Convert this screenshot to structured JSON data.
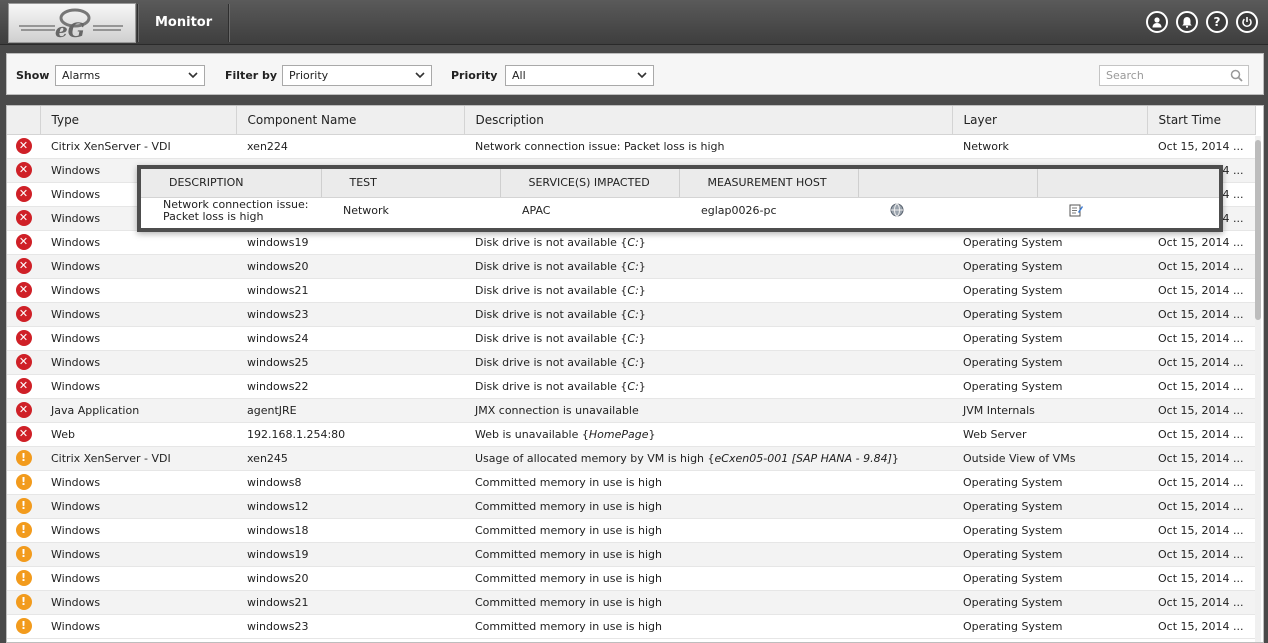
{
  "header": {
    "title": "Monitor",
    "icons": [
      "user-icon",
      "bell-icon",
      "help-icon",
      "power-icon"
    ]
  },
  "filters": {
    "show_label": "Show",
    "show_value": "Alarms",
    "filter_by_label": "Filter by",
    "filter_by_value": "Priority",
    "priority_label": "Priority",
    "priority_value": "All",
    "search_placeholder": "Search"
  },
  "table": {
    "columns": [
      "Type",
      "Component Name",
      "Description",
      "Layer",
      "Start Time"
    ],
    "rows": [
      {
        "priority": "critical",
        "type": "Citrix XenServer - VDI",
        "component": "xen224",
        "desc": "Network connection issue: Packet loss is high",
        "desc_em": "",
        "layer": "Network",
        "start": "Oct 15, 2014 ..."
      },
      {
        "priority": "critical",
        "type": "Windows",
        "component": "",
        "desc": "",
        "desc_em": "",
        "layer": "",
        "start": "Oct 15, 2014 ..."
      },
      {
        "priority": "critical",
        "type": "Windows",
        "component": "",
        "desc": "",
        "desc_em": "",
        "layer": "",
        "start": "Oct 15, 2014 ..."
      },
      {
        "priority": "critical",
        "type": "Windows",
        "component": "",
        "desc": "",
        "desc_em": "",
        "layer": "",
        "start": "Oct 15, 2014 ..."
      },
      {
        "priority": "critical",
        "type": "Windows",
        "component": "windows19",
        "desc": "Disk drive is not available {",
        "desc_em": "C:",
        "layer": "Operating System",
        "start": "Oct 15, 2014 ..."
      },
      {
        "priority": "critical",
        "type": "Windows",
        "component": "windows20",
        "desc": "Disk drive is not available {",
        "desc_em": "C:",
        "layer": "Operating System",
        "start": "Oct 15, 2014 ..."
      },
      {
        "priority": "critical",
        "type": "Windows",
        "component": "windows21",
        "desc": "Disk drive is not available {",
        "desc_em": "C:",
        "layer": "Operating System",
        "start": "Oct 15, 2014 ..."
      },
      {
        "priority": "critical",
        "type": "Windows",
        "component": "windows23",
        "desc": "Disk drive is not available {",
        "desc_em": "C:",
        "layer": "Operating System",
        "start": "Oct 15, 2014 ..."
      },
      {
        "priority": "critical",
        "type": "Windows",
        "component": "windows24",
        "desc": "Disk drive is not available {",
        "desc_em": "C:",
        "layer": "Operating System",
        "start": "Oct 15, 2014 ..."
      },
      {
        "priority": "critical",
        "type": "Windows",
        "component": "windows25",
        "desc": "Disk drive is not available {",
        "desc_em": "C:",
        "layer": "Operating System",
        "start": "Oct 15, 2014 ..."
      },
      {
        "priority": "critical",
        "type": "Windows",
        "component": "windows22",
        "desc": "Disk drive is not available {",
        "desc_em": "C:",
        "layer": "Operating System",
        "start": "Oct 15, 2014 ..."
      },
      {
        "priority": "critical",
        "type": "Java Application",
        "component": "agentJRE",
        "desc": "JMX connection is unavailable",
        "desc_em": "",
        "layer": "JVM Internals",
        "start": "Oct 15, 2014 ..."
      },
      {
        "priority": "critical",
        "type": "Web",
        "component": "192.168.1.254:80",
        "desc": "Web is unavailable {",
        "desc_em": "HomePage",
        "layer": "Web Server",
        "start": "Oct 15, 2014 ..."
      },
      {
        "priority": "major",
        "type": "Citrix XenServer - VDI",
        "component": "xen245",
        "desc": "Usage of allocated memory by VM is high {",
        "desc_em": "eCxen05-001 [SAP HANA - 9.84]",
        "layer": "Outside View of VMs",
        "start": "Oct 15, 2014 ..."
      },
      {
        "priority": "major",
        "type": "Windows",
        "component": "windows8",
        "desc": "Committed memory in use is high",
        "desc_em": "",
        "layer": "Operating System",
        "start": "Oct 15, 2014 ..."
      },
      {
        "priority": "major",
        "type": "Windows",
        "component": "windows12",
        "desc": "Committed memory in use is high",
        "desc_em": "",
        "layer": "Operating System",
        "start": "Oct 15, 2014 ..."
      },
      {
        "priority": "major",
        "type": "Windows",
        "component": "windows18",
        "desc": "Committed memory in use is high",
        "desc_em": "",
        "layer": "Operating System",
        "start": "Oct 15, 2014 ..."
      },
      {
        "priority": "major",
        "type": "Windows",
        "component": "windows19",
        "desc": "Committed memory in use is high",
        "desc_em": "",
        "layer": "Operating System",
        "start": "Oct 15, 2014 ..."
      },
      {
        "priority": "major",
        "type": "Windows",
        "component": "windows20",
        "desc": "Committed memory in use is high",
        "desc_em": "",
        "layer": "Operating System",
        "start": "Oct 15, 2014 ..."
      },
      {
        "priority": "major",
        "type": "Windows",
        "component": "windows21",
        "desc": "Committed memory in use is high",
        "desc_em": "",
        "layer": "Operating System",
        "start": "Oct 15, 2014 ..."
      },
      {
        "priority": "major",
        "type": "Windows",
        "component": "windows23",
        "desc": "Committed memory in use is high",
        "desc_em": "",
        "layer": "Operating System",
        "start": "Oct 15, 2014 ..."
      }
    ]
  },
  "popup": {
    "columns": [
      "DESCRIPTION",
      "TEST",
      "SERVICE(S) IMPACTED",
      "MEASUREMENT HOST"
    ],
    "description": "Network connection issue: Packet loss is high",
    "test": "Network",
    "services": "APAC",
    "host": "eglap0026-pc",
    "icons": [
      "globe-icon",
      "edit-icon"
    ]
  },
  "colors": {
    "critical": "#cf2027",
    "major": "#f29b1d",
    "header_bg": "#4a4a4a"
  }
}
